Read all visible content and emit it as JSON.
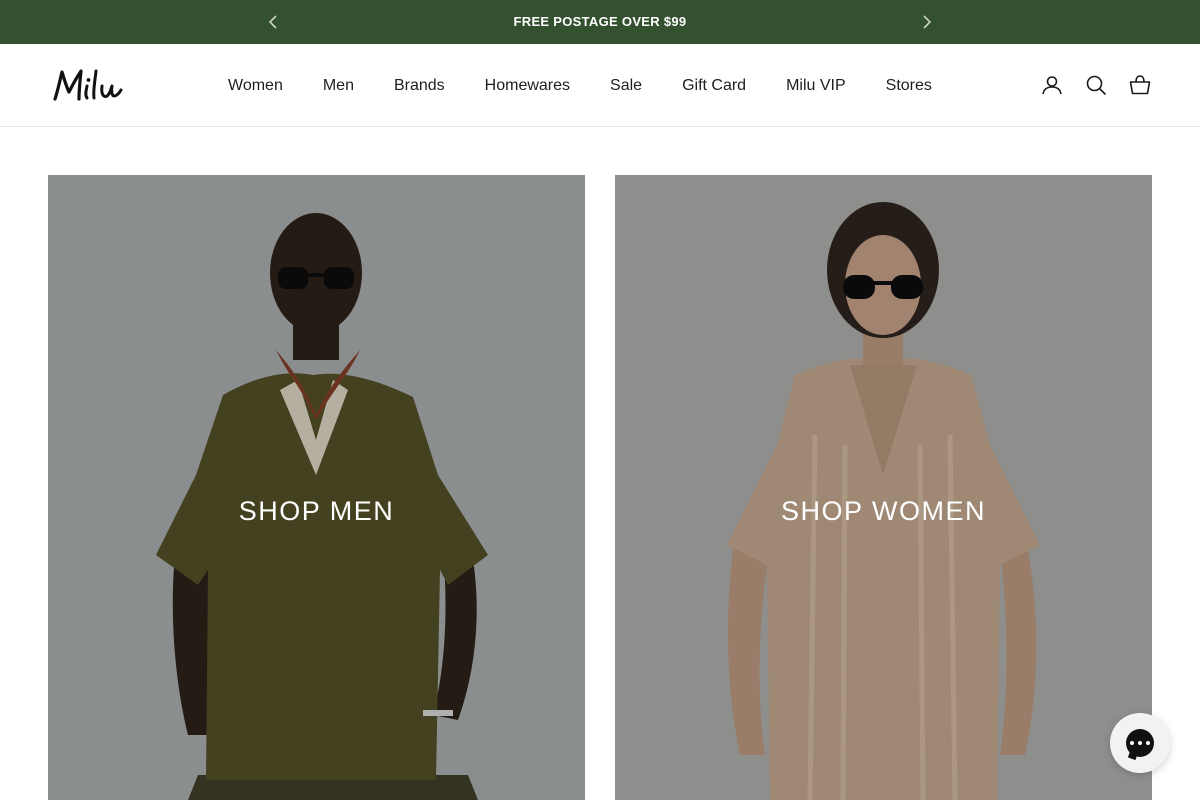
{
  "announcement": {
    "message": "FREE POSTAGE OVER $99",
    "prev_icon": "chevron-left-icon",
    "next_icon": "chevron-right-icon",
    "background": "#33502f"
  },
  "header": {
    "logo_text": "Milu",
    "nav": [
      {
        "label": "Women"
      },
      {
        "label": "Men"
      },
      {
        "label": "Brands"
      },
      {
        "label": "Homewares"
      },
      {
        "label": "Sale"
      },
      {
        "label": "Gift Card"
      },
      {
        "label": "Milu VIP"
      },
      {
        "label": "Stores"
      }
    ],
    "icons": [
      "account-icon",
      "search-icon",
      "cart-icon"
    ]
  },
  "collections": [
    {
      "label": "SHOP MEN",
      "image": "man in olive knit polo shirt and sunglasses"
    },
    {
      "label": "SHOP WOMEN",
      "image": "woman in beige striped towelling dress and sunglasses"
    }
  ],
  "chat": {
    "icon": "chat-icon"
  }
}
